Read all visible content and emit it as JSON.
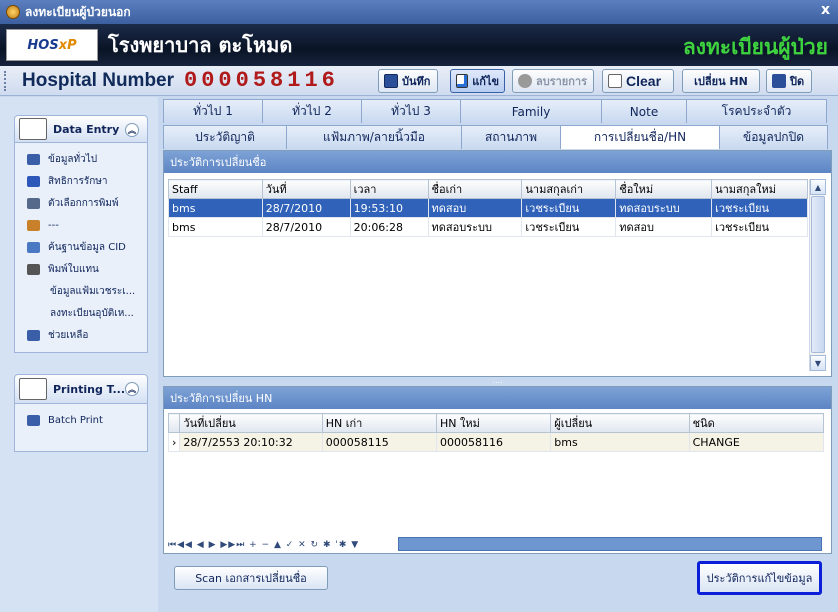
{
  "window": {
    "title": "ลงทะเบียนผู้ป่วยนอก"
  },
  "banner": {
    "logo_text": "HOS",
    "logo_xp": "xP",
    "hospital_name": "โรงพยาบาล ตะโหมด",
    "section_title": "ลงทะเบียนผู้ป่วย"
  },
  "toolbar": {
    "hn_label": "Hospital Number",
    "hn_value": "000058116",
    "save_label": "บันทึก",
    "edit_label": "แก้ไข",
    "delete_label": "ลบรายการ",
    "clear_label": "Clear",
    "change_hn_label": "เปลี่ยน HN",
    "close_label": "ปิด"
  },
  "sidebar": {
    "groups": [
      {
        "title": "Data Entry",
        "items": [
          {
            "label": "ข้อมูลทั่วไป",
            "icon": "glasses-icon",
            "color": "#3a5fa8"
          },
          {
            "label": "สิทธิการรักษา",
            "icon": "card-icon",
            "color": "#2d57b8"
          },
          {
            "label": "ตัวเลือกการพิมพ์",
            "icon": "print-options-icon",
            "color": "#556a8a"
          },
          {
            "label": "---",
            "icon": "users-icon",
            "color": "#c8812a"
          },
          {
            "label": "ค้นฐานข้อมูล CID",
            "icon": "database-search-icon",
            "color": "#4a78c2"
          },
          {
            "label": "พิมพ์ใบแทน",
            "icon": "printer-icon",
            "color": "#555555"
          },
          {
            "label": "ข้อมูลแฟ้มเวชระเ...",
            "icon": "",
            "color": ""
          },
          {
            "label": "ลงทะเบียนอุบัติเห...",
            "icon": "",
            "color": ""
          },
          {
            "label": "ช่วยเหลือ",
            "icon": "help-icon",
            "color": "#3a5fa8"
          }
        ]
      },
      {
        "title": "Printing T...",
        "items": [
          {
            "label": "Batch Print",
            "icon": "batch-print-icon",
            "color": "#3a5fa8"
          }
        ]
      }
    ]
  },
  "tabs": {
    "row1": [
      "ทั่วไป 1",
      "ทั่วไป 2",
      "ทั่วไป 3",
      "Family",
      "Note",
      "โรคประจำตัว"
    ],
    "row2": [
      "ประวัติญาติ",
      "แฟ้มภาพ/ลายนิ้วมือ",
      "สถานภาพ",
      "การเปลี่ยนชื่อ/HN",
      "ข้อมูลปกปิด"
    ],
    "active_row2": 3
  },
  "name_history": {
    "title": "ประวัติการเปลี่ยนชื่อ",
    "columns": [
      "Staff",
      "วันที่",
      "เวลา",
      "ชื่อเก่า",
      "นามสกุลเก่า",
      "ชื่อใหม่",
      "นามสกุลใหม่"
    ],
    "rows": [
      [
        "bms",
        "28/7/2010",
        "19:53:10",
        "ทดสอบ",
        "เวชระเบียน",
        "ทดสอบระบบ",
        "เวชระเบียน"
      ],
      [
        "bms",
        "28/7/2010",
        "20:06:28",
        "ทดสอบระบบ",
        "เวชระเบียน",
        "ทดสอบ",
        "เวชระเบียน"
      ]
    ]
  },
  "hn_history": {
    "title": "ประวัติการเปลี่ยน HN",
    "columns": [
      "วันที่เปลี่ยน",
      "HN เก่า",
      "HN ใหม่",
      "ผู้เปลี่ยน",
      "ชนิด"
    ],
    "rows": [
      [
        "28/7/2553 20:10:32",
        "000058115",
        "000058116",
        "bms",
        "CHANGE"
      ]
    ],
    "navigator": "⏮◀◀ ◀ ▶ ▶▶⏭ + − ▲ ✓ ✕ ↻ ✱ '✱ ▼"
  },
  "buttons": {
    "scan_label": "Scan เอกสารเปลี่ยนชื่อ",
    "history_label": "ประวัติการแก้ไขข้อมูล"
  }
}
